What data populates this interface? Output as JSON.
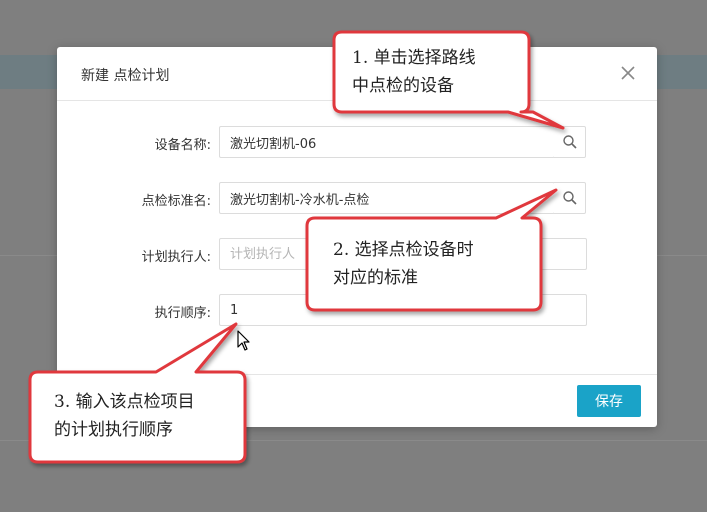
{
  "dialog": {
    "title": "新建 点检计划",
    "fields": [
      {
        "label": "设备名称:",
        "value": "激光切割机-06"
      },
      {
        "label": "点检标准名:",
        "value": "激光切割机-冷水机-点检"
      },
      {
        "label": "计划执行人:",
        "value": "",
        "placeholder": "计划执行人"
      },
      {
        "label": "执行顺序:",
        "value": "1"
      }
    ],
    "save_label": "保存"
  },
  "callouts": [
    {
      "line1": "1. 单击选择路线",
      "line2": "中点检的设备"
    },
    {
      "line1": "2. 选择点检设备时",
      "line2": "对应的标准"
    },
    {
      "line1": "3. 输入该点检项目",
      "line2": "的计划执行顺序"
    }
  ],
  "colors": {
    "primary": "#1aa3c8",
    "callout_border": "#e0393e",
    "overlay": "#7f7f7f"
  },
  "icons": [
    "close-icon",
    "search-icon",
    "cursor-arrow-icon"
  ]
}
